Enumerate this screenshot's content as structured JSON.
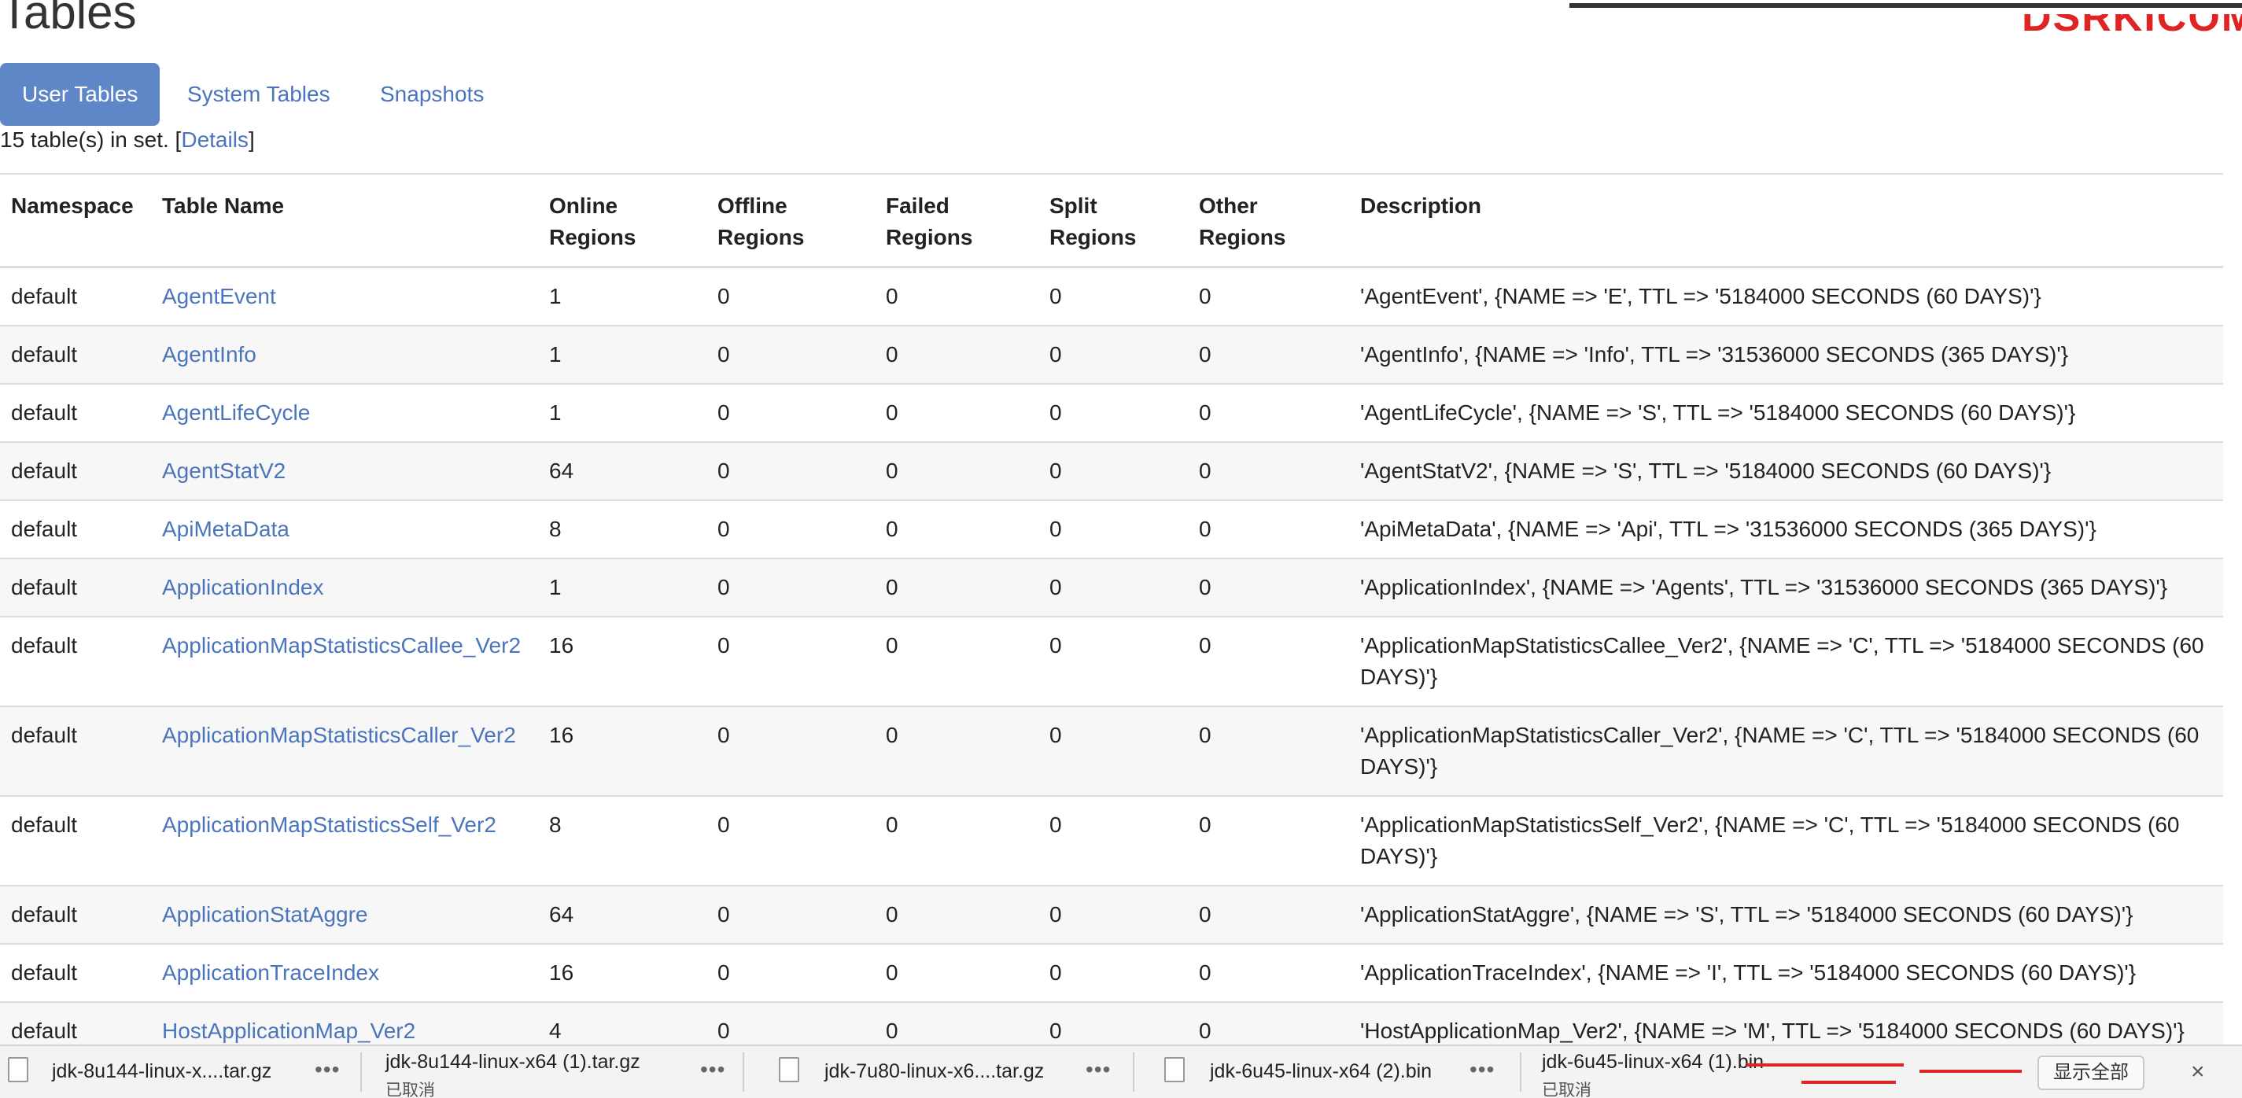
{
  "page": {
    "title": "Tables"
  },
  "brand": {
    "watermark_text": "DSRKICOM",
    "color": "#e02424"
  },
  "tabs": [
    {
      "label": "User Tables",
      "active": true
    },
    {
      "label": "System Tables",
      "active": false
    },
    {
      "label": "Snapshots",
      "active": false
    }
  ],
  "summary": {
    "prefix": "15 table(s) in set. [",
    "link": "Details",
    "suffix": "]"
  },
  "table": {
    "headers": {
      "namespace": "Namespace",
      "table_name": "Table Name",
      "online": "Online Regions",
      "offline": "Offline Regions",
      "failed": "Failed Regions",
      "split": "Split Regions",
      "other": "Other Regions",
      "description": "Description"
    },
    "rows": [
      {
        "namespace": "default",
        "name": "AgentEvent",
        "online": "1",
        "offline": "0",
        "failed": "0",
        "split": "0",
        "other": "0",
        "description": "'AgentEvent', {NAME => 'E', TTL => '5184000 SECONDS (60 DAYS)'}"
      },
      {
        "namespace": "default",
        "name": "AgentInfo",
        "online": "1",
        "offline": "0",
        "failed": "0",
        "split": "0",
        "other": "0",
        "description": "'AgentInfo', {NAME => 'Info', TTL => '31536000 SECONDS (365 DAYS)'}"
      },
      {
        "namespace": "default",
        "name": "AgentLifeCycle",
        "online": "1",
        "offline": "0",
        "failed": "0",
        "split": "0",
        "other": "0",
        "description": "'AgentLifeCycle', {NAME => 'S', TTL => '5184000 SECONDS (60 DAYS)'}"
      },
      {
        "namespace": "default",
        "name": "AgentStatV2",
        "online": "64",
        "offline": "0",
        "failed": "0",
        "split": "0",
        "other": "0",
        "description": "'AgentStatV2', {NAME => 'S', TTL => '5184000 SECONDS (60 DAYS)'}"
      },
      {
        "namespace": "default",
        "name": "ApiMetaData",
        "online": "8",
        "offline": "0",
        "failed": "0",
        "split": "0",
        "other": "0",
        "description": "'ApiMetaData', {NAME => 'Api', TTL => '31536000 SECONDS (365 DAYS)'}"
      },
      {
        "namespace": "default",
        "name": "ApplicationIndex",
        "online": "1",
        "offline": "0",
        "failed": "0",
        "split": "0",
        "other": "0",
        "description": "'ApplicationIndex', {NAME => 'Agents', TTL => '31536000 SECONDS (365 DAYS)'}"
      },
      {
        "namespace": "default",
        "name": "ApplicationMapStatisticsCallee_Ver2",
        "online": "16",
        "offline": "0",
        "failed": "0",
        "split": "0",
        "other": "0",
        "description": "'ApplicationMapStatisticsCallee_Ver2', {NAME => 'C', TTL => '5184000 SECONDS (60 DAYS)'}"
      },
      {
        "namespace": "default",
        "name": "ApplicationMapStatisticsCaller_Ver2",
        "online": "16",
        "offline": "0",
        "failed": "0",
        "split": "0",
        "other": "0",
        "description": "'ApplicationMapStatisticsCaller_Ver2', {NAME => 'C', TTL => '5184000 SECONDS (60 DAYS)'}"
      },
      {
        "namespace": "default",
        "name": "ApplicationMapStatisticsSelf_Ver2",
        "online": "8",
        "offline": "0",
        "failed": "0",
        "split": "0",
        "other": "0",
        "description": "'ApplicationMapStatisticsSelf_Ver2', {NAME => 'C', TTL => '5184000 SECONDS (60 DAYS)'}"
      },
      {
        "namespace": "default",
        "name": "ApplicationStatAggre",
        "online": "64",
        "offline": "0",
        "failed": "0",
        "split": "0",
        "other": "0",
        "description": "'ApplicationStatAggre', {NAME => 'S', TTL => '5184000 SECONDS (60 DAYS)'}"
      },
      {
        "namespace": "default",
        "name": "ApplicationTraceIndex",
        "online": "16",
        "offline": "0",
        "failed": "0",
        "split": "0",
        "other": "0",
        "description": "'ApplicationTraceIndex', {NAME => 'I', TTL => '5184000 SECONDS (60 DAYS)'}"
      },
      {
        "namespace": "default",
        "name": "HostApplicationMap_Ver2",
        "online": "4",
        "offline": "0",
        "failed": "0",
        "split": "0",
        "other": "0",
        "description": "'HostApplicationMap_Ver2', {NAME => 'M', TTL => '5184000 SECONDS (60 DAYS)'}"
      }
    ]
  },
  "downloads": {
    "items": [
      {
        "name": "jdk-8u144-linux-x....tar.gz",
        "status": "",
        "more": "•••"
      },
      {
        "name": "jdk-8u144-linux-x64 (1).tar.gz",
        "status": "已取消",
        "more": "•••"
      },
      {
        "name": "jdk-7u80-linux-x6....tar.gz",
        "status": "",
        "more": "•••"
      },
      {
        "name": "jdk-6u45-linux-x64 (2).bin",
        "status": "",
        "more": "•••"
      },
      {
        "name": "jdk-6u45-linux-x64 (1).bin",
        "status": "已取消",
        "more": ""
      }
    ],
    "show_all": "显示全部",
    "close": "×"
  }
}
